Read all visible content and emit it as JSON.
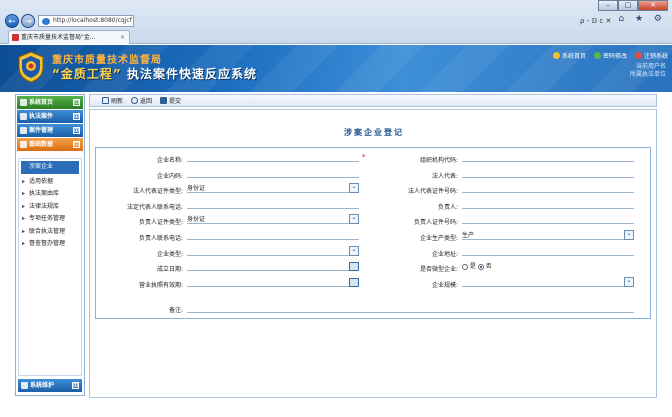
{
  "browser": {
    "address": "http://localhost:8080/cqjcf",
    "address_tools": "ρ - 𝔻 c ✕",
    "tab_title": "重庆市质量技术监督局\"金...",
    "tab_close": "×",
    "actions": "⌂ ★ ⚙",
    "window_buttons": [
      "–",
      "□",
      "✕"
    ],
    "nav_back": "←",
    "nav_forward": "→"
  },
  "header": {
    "org_name": "重庆市质量技术监督局",
    "system_name_q1": "“",
    "system_name_q2": "金质工程",
    "system_name_q3": "”",
    "system_name_rest": " 执法案件快速反应系统",
    "links": [
      {
        "label": "系统首页",
        "color": "#f2c230"
      },
      {
        "label": "密码修改",
        "color": "#57b84b"
      },
      {
        "label": "注销系统",
        "color": "#e24b3a"
      }
    ],
    "user_line1": "当前用户名",
    "user_line2": "所属执法单位"
  },
  "sidebar": {
    "heads": [
      {
        "label": "系统首页",
        "toggle": "⊟"
      },
      {
        "label": "执法案件",
        "toggle": "⊞"
      },
      {
        "label": "案件管理",
        "toggle": "⊞"
      },
      {
        "label": "基础数据",
        "toggle": "⊟"
      }
    ],
    "items": [
      {
        "label": "涉案企业"
      },
      {
        "label": "适用依据"
      },
      {
        "label": "执法案由库"
      },
      {
        "label": "法律法规库"
      },
      {
        "label": "专项任务管理"
      },
      {
        "label": "联合执法管理"
      },
      {
        "label": "督查督办管理"
      }
    ],
    "footer": {
      "label": "系统维护",
      "toggle": "⊞"
    }
  },
  "toolbar": {
    "refresh": "刷新",
    "back": "返回",
    "submit": "提交"
  },
  "form": {
    "title": "涉案企业登记",
    "required_mark": "*",
    "left": [
      {
        "label": "企业名称:",
        "value": "",
        "type": "text"
      },
      {
        "label": "企业内码:",
        "value": "",
        "type": "text"
      },
      {
        "label": "法人代表证件类型:",
        "value": "身份证",
        "type": "select"
      },
      {
        "label": "法定代表人联系电话:",
        "value": "",
        "type": "text"
      },
      {
        "label": "负责人证件类型:",
        "value": "身份证",
        "type": "select"
      },
      {
        "label": "负责人联系电话:",
        "value": "",
        "type": "text"
      },
      {
        "label": "企业类型:",
        "value": "",
        "type": "select"
      },
      {
        "label": "成立日期:",
        "value": "",
        "type": "date"
      },
      {
        "label": "营业执照有效期:",
        "value": "",
        "type": "date"
      }
    ],
    "right": [
      {
        "label": "组织机构代码:",
        "value": "",
        "type": "text"
      },
      {
        "label": "法人代表:",
        "value": "",
        "type": "text"
      },
      {
        "label": "法人代表证件号码:",
        "value": "",
        "type": "text"
      },
      {
        "label": "负责人:",
        "value": "",
        "type": "text"
      },
      {
        "label": "负责人证件号码:",
        "value": "",
        "type": "text"
      },
      {
        "label": "企业生产类型:",
        "value": "生产",
        "type": "select"
      },
      {
        "label": "企业地址:",
        "value": "",
        "type": "text"
      },
      {
        "label": "是否微型企业:",
        "value": "",
        "type": "radio"
      },
      {
        "label": "企业规模:",
        "value": "",
        "type": "select"
      }
    ],
    "radio_yes": "是",
    "radio_no": "否",
    "remarks_label": "备注:"
  }
}
